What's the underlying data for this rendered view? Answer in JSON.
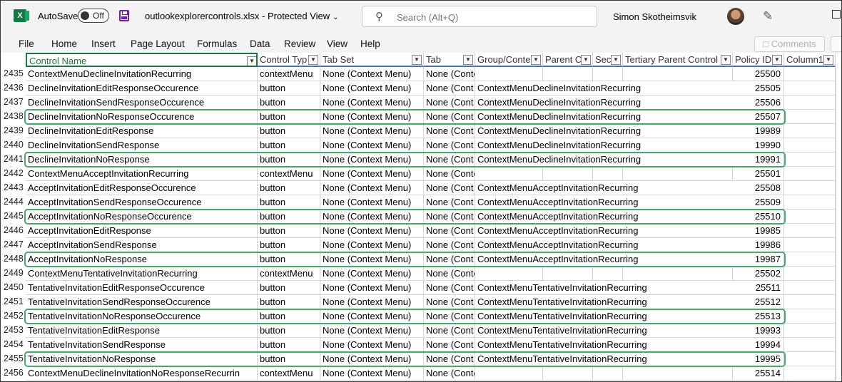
{
  "titlebar": {
    "autosave_label": "AutoSave",
    "autosave_state": "Off",
    "filename": "outlookexplorercontrols.xlsx  -  Protected View",
    "search_placeholder": "Search (Alt+Q)",
    "user_name": "Simon Skotheimsvik"
  },
  "menu": [
    "File",
    "Home",
    "Insert",
    "Page Layout",
    "Formulas",
    "Data",
    "Review",
    "View",
    "Help"
  ],
  "comments_label": "Comments",
  "columns": [
    "Control Name",
    "Control Typ",
    "Tab Set",
    "Tab",
    "Group/Conte",
    "Parent C",
    "Sec",
    "Tertiary Parent Control",
    "Policy ID",
    "Column1"
  ],
  "rows": [
    {
      "n": "2435",
      "name": "ContextMenuDeclineInvitationRecurring",
      "type": "contextMenu",
      "tabset": "None (Context Menu)",
      "tab": "None (Context Menu)",
      "group": "",
      "policy": "25500",
      "hl": false
    },
    {
      "n": "2436",
      "name": "DeclineInvitationEditResponseOccurence",
      "type": "button",
      "tabset": "None (Context Menu)",
      "tab": "None (Cont",
      "group": "ContextMenuDeclineInvitationRecurring",
      "policy": "25505",
      "hl": false
    },
    {
      "n": "2437",
      "name": "DeclineInvitationSendResponseOccurence",
      "type": "button",
      "tabset": "None (Context Menu)",
      "tab": "None (Cont",
      "group": "ContextMenuDeclineInvitationRecurring",
      "policy": "25506",
      "hl": false
    },
    {
      "n": "2438",
      "name": "DeclineInvitationNoResponseOccurence",
      "type": "button",
      "tabset": "None (Context Menu)",
      "tab": "None (Cont",
      "group": "ContextMenuDeclineInvitationRecurring",
      "policy": "25507",
      "hl": true
    },
    {
      "n": "2439",
      "name": "DeclineInvitationEditResponse",
      "type": "button",
      "tabset": "None (Context Menu)",
      "tab": "None (Cont",
      "group": "ContextMenuDeclineInvitationRecurring",
      "policy": "19989",
      "hl": false
    },
    {
      "n": "2440",
      "name": "DeclineInvitationSendResponse",
      "type": "button",
      "tabset": "None (Context Menu)",
      "tab": "None (Cont",
      "group": "ContextMenuDeclineInvitationRecurring",
      "policy": "19990",
      "hl": false
    },
    {
      "n": "2441",
      "name": "DeclineInvitationNoResponse",
      "type": "button",
      "tabset": "None (Context Menu)",
      "tab": "None (Cont",
      "group": "ContextMenuDeclineInvitationRecurring",
      "policy": "19991",
      "hl": true
    },
    {
      "n": "2442",
      "name": "ContextMenuAcceptInvitationRecurring",
      "type": "contextMenu",
      "tabset": "None (Context Menu)",
      "tab": "None (Context Menu)",
      "group": "",
      "policy": "25501",
      "hl": false
    },
    {
      "n": "2443",
      "name": "AcceptInvitationEditResponseOccurence",
      "type": "button",
      "tabset": "None (Context Menu)",
      "tab": "None (Cont",
      "group": "ContextMenuAcceptInvitationRecurring",
      "policy": "25508",
      "hl": false
    },
    {
      "n": "2444",
      "name": "AcceptInvitationSendResponseOccurence",
      "type": "button",
      "tabset": "None (Context Menu)",
      "tab": "None (Cont",
      "group": "ContextMenuAcceptInvitationRecurring",
      "policy": "25509",
      "hl": false
    },
    {
      "n": "2445",
      "name": "AcceptInvitationNoResponseOccurence",
      "type": "button",
      "tabset": "None (Context Menu)",
      "tab": "None (Cont",
      "group": "ContextMenuAcceptInvitationRecurring",
      "policy": "25510",
      "hl": true
    },
    {
      "n": "2446",
      "name": "AcceptInvitationEditResponse",
      "type": "button",
      "tabset": "None (Context Menu)",
      "tab": "None (Cont",
      "group": "ContextMenuAcceptInvitationRecurring",
      "policy": "19985",
      "hl": false
    },
    {
      "n": "2447",
      "name": "AcceptInvitationSendResponse",
      "type": "button",
      "tabset": "None (Context Menu)",
      "tab": "None (Cont",
      "group": "ContextMenuAcceptInvitationRecurring",
      "policy": "19986",
      "hl": false
    },
    {
      "n": "2448",
      "name": "AcceptInvitationNoResponse",
      "type": "button",
      "tabset": "None (Context Menu)",
      "tab": "None (Cont",
      "group": "ContextMenuAcceptInvitationRecurring",
      "policy": "19987",
      "hl": true
    },
    {
      "n": "2449",
      "name": "ContextMenuTentativeInvitationRecurring",
      "type": "contextMenu",
      "tabset": "None (Context Menu)",
      "tab": "None (Context Menu)",
      "group": "",
      "policy": "25502",
      "hl": false
    },
    {
      "n": "2450",
      "name": "TentativeInvitationEditResponseOccurence",
      "type": "button",
      "tabset": "None (Context Menu)",
      "tab": "None (Cont",
      "group": "ContextMenuTentativeInvitationRecurring",
      "policy": "25511",
      "hl": false
    },
    {
      "n": "2451",
      "name": "TentativeInvitationSendResponseOccurence",
      "type": "button",
      "tabset": "None (Context Menu)",
      "tab": "None (Cont",
      "group": "ContextMenuTentativeInvitationRecurring",
      "policy": "25512",
      "hl": false
    },
    {
      "n": "2452",
      "name": "TentativeInvitationNoResponseOccurence",
      "type": "button",
      "tabset": "None (Context Menu)",
      "tab": "None (Cont",
      "group": "ContextMenuTentativeInvitationRecurring",
      "policy": "25513",
      "hl": true
    },
    {
      "n": "2453",
      "name": "TentativeInvitationEditResponse",
      "type": "button",
      "tabset": "None (Context Menu)",
      "tab": "None (Cont",
      "group": "ContextMenuTentativeInvitationRecurring",
      "policy": "19993",
      "hl": false
    },
    {
      "n": "2454",
      "name": "TentativeInvitationSendResponse",
      "type": "button",
      "tabset": "None (Context Menu)",
      "tab": "None (Cont",
      "group": "ContextMenuTentativeInvitationRecurring",
      "policy": "19994",
      "hl": false
    },
    {
      "n": "2455",
      "name": "TentativeInvitationNoResponse",
      "type": "button",
      "tabset": "None (Context Menu)",
      "tab": "None (Cont",
      "group": "ContextMenuTentativeInvitationRecurring",
      "policy": "19995",
      "hl": true
    },
    {
      "n": "2456",
      "name": "ContextMenuDeclineInvitationNoResponseRecurrin",
      "type": "contextMenu",
      "tabset": "None (Context Menu)",
      "tab": "None (Context Menu)",
      "group": "",
      "policy": "25514",
      "hl": false
    }
  ],
  "colors": {
    "highlight": "#4aa772",
    "excel_green": "#107c41",
    "header_rule": "#4472c4"
  }
}
